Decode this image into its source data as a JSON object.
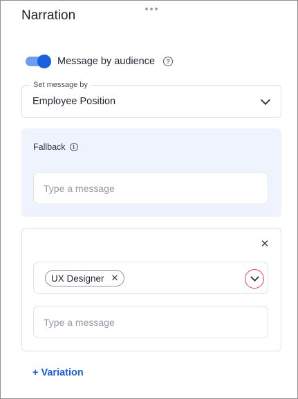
{
  "panel": {
    "title": "Narration"
  },
  "audience_toggle": {
    "label": "Message by audience",
    "enabled": true,
    "help_icon": "question-circle-icon"
  },
  "message_by": {
    "legend": "Set message by",
    "value": "Employee Position",
    "icon": "chevron-down-icon"
  },
  "fallback": {
    "label": "Fallback",
    "info_icon": "info-circle-icon",
    "input": {
      "placeholder": "Type a message",
      "value": ""
    }
  },
  "variation": {
    "close_icon": "close-icon",
    "selected_tags": [
      "UX Designer"
    ],
    "tag_remove_icon": "close-icon",
    "expand_icon": "chevron-down-icon",
    "input": {
      "placeholder": "Type a message",
      "value": ""
    }
  },
  "add_variation_label": "+ Variation",
  "colors": {
    "accent": "#1a5fe0",
    "fallback_bg": "#eef3fd",
    "highlight_ring": "#e0454f"
  }
}
